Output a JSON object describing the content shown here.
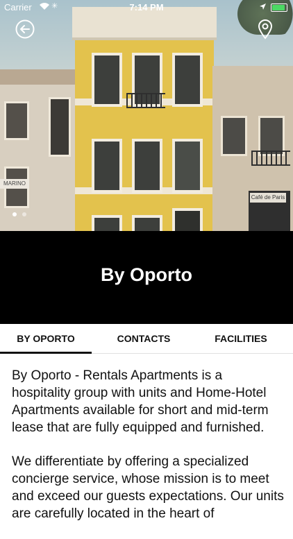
{
  "status_bar": {
    "carrier": "Carrier",
    "time": "7:14 PM",
    "icons": [
      "wifi-icon",
      "activity-icon",
      "location-arrow-icon",
      "battery-icon"
    ]
  },
  "hero": {
    "back_icon": "back-arrow-circle-icon",
    "map_icon": "map-pin-icon",
    "photo_text": {
      "left_shop": "MARINO",
      "right_shop": "Café de Paris"
    },
    "carousel": {
      "count": 2,
      "active_index": 0
    }
  },
  "banner": {
    "title": "By Oporto"
  },
  "tabs": [
    {
      "label": "BY OPORTO",
      "active": true
    },
    {
      "label": "CONTACTS",
      "active": false
    },
    {
      "label": "FACILITIES",
      "active": false
    }
  ],
  "content": {
    "paragraphs": [
      "By Oporto - Rentals Apartments is a hospitality group with units and Home-Hotel Apartments available for short and mid-term lease that are fully equipped and furnished.",
      "We differentiate by offering a specialized concierge service, whose mission is to meet and exceed our guests expectations. Our units are carefully located in the heart of"
    ]
  },
  "colors": {
    "banner_bg": "#000000",
    "battery": "#4cd964",
    "text": "#111111"
  }
}
